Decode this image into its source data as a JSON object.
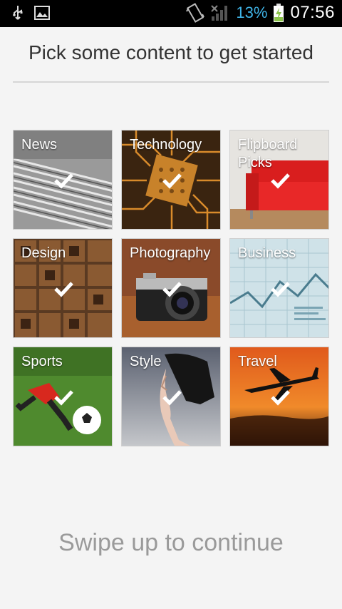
{
  "status_bar": {
    "battery_percent": "13%",
    "time": "07:56",
    "icons": [
      "usb-icon",
      "image-icon",
      "vibrate-icon",
      "no-signal-icon",
      "battery-charging-icon"
    ]
  },
  "header": {
    "title": "Pick some content to get started"
  },
  "categories": [
    {
      "label": "News",
      "selected": true
    },
    {
      "label": "Technology",
      "selected": true
    },
    {
      "label": "Flipboard Picks",
      "selected": true
    },
    {
      "label": "Design",
      "selected": true
    },
    {
      "label": "Photography",
      "selected": true
    },
    {
      "label": "Business",
      "selected": true
    },
    {
      "label": "Sports",
      "selected": true
    },
    {
      "label": "Style",
      "selected": true
    },
    {
      "label": "Travel",
      "selected": true
    }
  ],
  "footer": {
    "prompt": "Swipe up to continue"
  }
}
